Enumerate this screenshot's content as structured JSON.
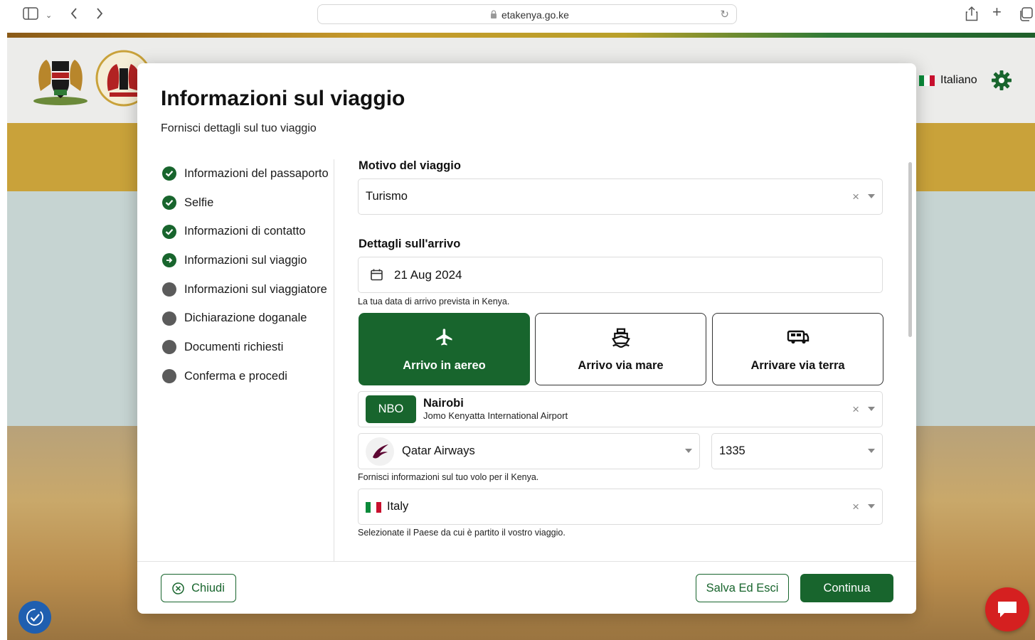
{
  "browser": {
    "url": "etakenya.go.ke"
  },
  "header": {
    "language": "Italiano"
  },
  "modal": {
    "title": "Informazioni sul viaggio",
    "subtitle": "Fornisci dettagli sul tuo viaggio",
    "steps": [
      {
        "label": "Informazioni del passaporto",
        "status": "done"
      },
      {
        "label": "Selfie",
        "status": "done"
      },
      {
        "label": "Informazioni di contatto",
        "status": "done"
      },
      {
        "label": "Informazioni sul viaggio",
        "status": "current"
      },
      {
        "label": "Informazioni sul viaggiatore",
        "status": "todo"
      },
      {
        "label": "Dichiarazione doganale",
        "status": "todo"
      },
      {
        "label": "Documenti richiesti",
        "status": "todo"
      },
      {
        "label": "Conferma e procedi",
        "status": "todo"
      }
    ],
    "purpose": {
      "label": "Motivo del viaggio",
      "value": "Turismo"
    },
    "arrival": {
      "label": "Dettagli sull'arrivo",
      "date": "21 Aug 2024",
      "date_hint": "La tua data di arrivo prevista in Kenya.",
      "modes": [
        {
          "label": "Arrivo in aereo",
          "icon": "airplane-icon",
          "selected": true
        },
        {
          "label": "Arrivo via mare",
          "icon": "ship-icon",
          "selected": false
        },
        {
          "label": "Arrivare via terra",
          "icon": "bus-icon",
          "selected": false
        }
      ],
      "airport": {
        "code": "NBO",
        "city": "Nairobi",
        "name": "Jomo Kenyatta International Airport"
      },
      "airline": "Qatar Airways",
      "flight_number": "1335",
      "flight_hint": "Fornisci informazioni sul tuo volo per il Kenya.",
      "departure_country": "Italy",
      "country_hint": "Selezionate il Paese da cui è partito il vostro viaggio."
    },
    "buttons": {
      "close": "Chiudi",
      "save_exit": "Salva Ed Esci",
      "continue": "Continua"
    }
  },
  "colors": {
    "primary": "#18652d",
    "pending": "#5b5b5b",
    "chat": "#d52020",
    "accessibility": "#1f5fb0"
  }
}
